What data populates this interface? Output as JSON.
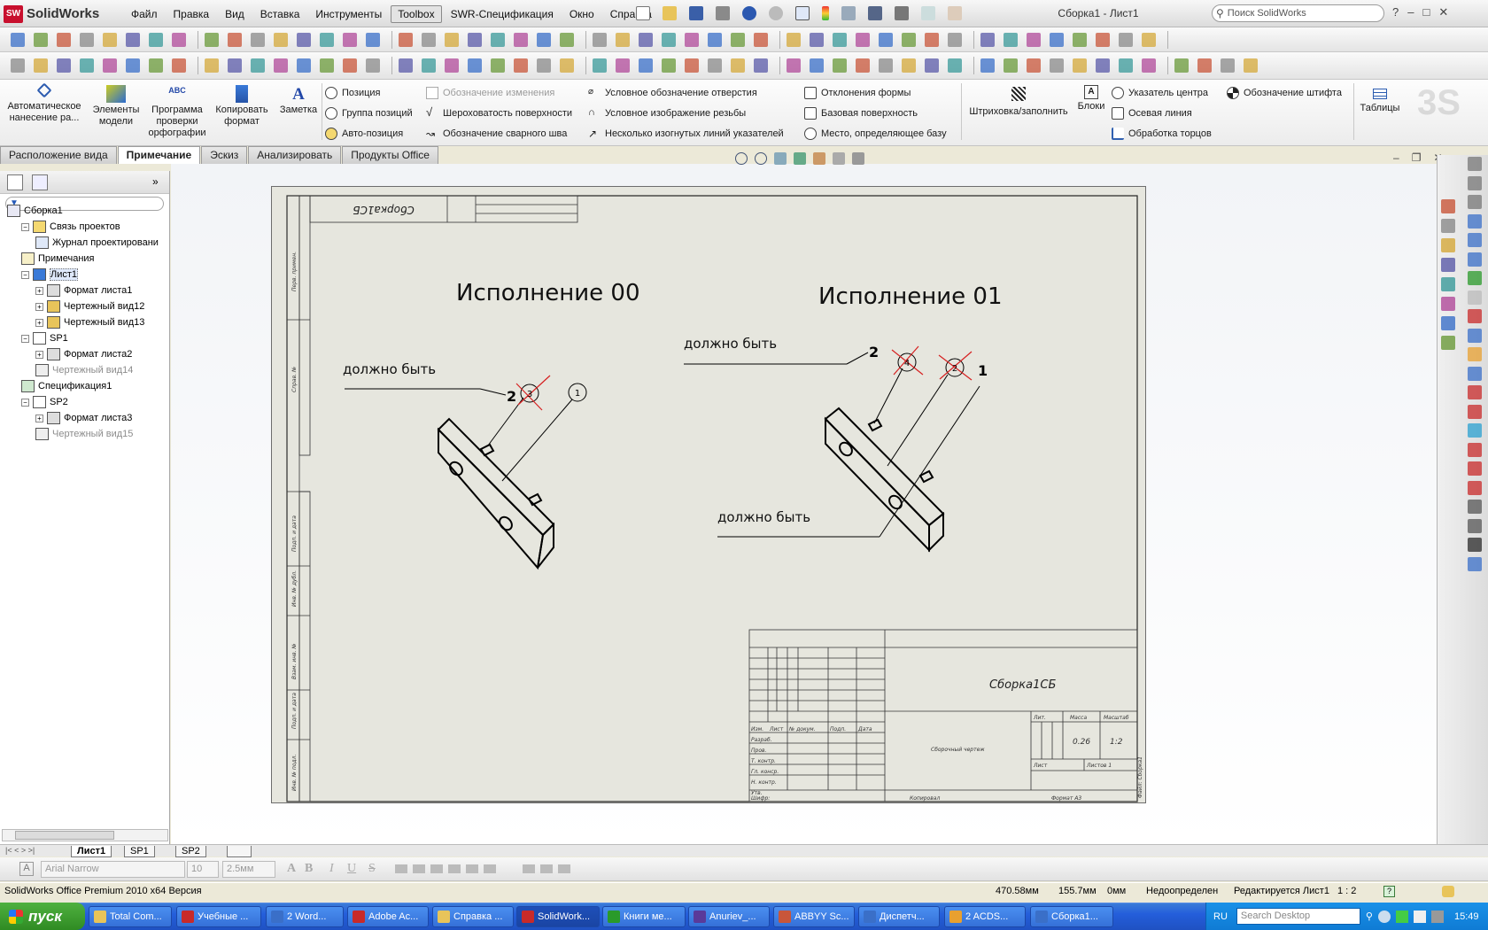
{
  "app": {
    "name": "SolidWorks",
    "logo_text": "SW",
    "doc_title": "Сборка1 - Лист1",
    "search_placeholder": "Поиск SolidWorks"
  },
  "menu": [
    "Файл",
    "Правка",
    "Вид",
    "Вставка",
    "Инструменты",
    "Toolbox",
    "SWR-Спецификация",
    "Окно",
    "Справка"
  ],
  "command_manager": {
    "big": [
      {
        "label": "Автоматическое нанесение ра...",
        "icon": "auto-dimension-icon"
      },
      {
        "label": "Элементы модели",
        "icon": "model-items-icon"
      },
      {
        "label": "Программа проверки орфографии",
        "icon": "spell-check-icon"
      },
      {
        "label": "Копировать формат",
        "icon": "format-painter-icon"
      },
      {
        "label": "Заметка",
        "icon": "note-icon"
      }
    ],
    "col1": [
      "Позиция",
      "Группа позиций",
      "Авто-позиция"
    ],
    "col2": [
      "Обозначение изменения",
      "Шероховатость поверхности",
      "Обозначение сварного шва"
    ],
    "col3": [
      "Условное обозначение отверстия",
      "Условное изображение резьбы",
      "Несколько изогнутых линий указателей"
    ],
    "col4": [
      "Отклонения формы",
      "Базовая поверхность",
      "Место, определяющее базу"
    ],
    "hatch": "Штриховка/заполнить",
    "blocks": "Блоки",
    "col5": [
      "Указатель центра",
      "Осевая линия",
      "Обработка торцов"
    ],
    "pin": "Обозначение штифта",
    "tables": "Таблицы"
  },
  "tabs": [
    "Расположение вида",
    "Примечание",
    "Эскиз",
    "Анализировать",
    "Продукты Office"
  ],
  "tree": [
    {
      "label": "Сборка1",
      "gray": false
    },
    {
      "label": "Связь проектов",
      "gray": false
    },
    {
      "label": "Журнал проектировани",
      "gray": false
    },
    {
      "label": "Примечания",
      "gray": false
    },
    {
      "label": "Лист1",
      "gray": false
    },
    {
      "label": "Формат листа1",
      "gray": false
    },
    {
      "label": "Чертежный вид12",
      "gray": false
    },
    {
      "label": "Чертежный вид13",
      "gray": false
    },
    {
      "label": "SP1",
      "gray": false
    },
    {
      "label": "Формат листа2",
      "gray": false
    },
    {
      "label": "Чертежный вид14",
      "gray": true
    },
    {
      "label": "Спецификация1",
      "gray": false
    },
    {
      "label": "SP2",
      "gray": false
    },
    {
      "label": "Формат листа3",
      "gray": false
    },
    {
      "label": "Чертежный вид15",
      "gray": true
    }
  ],
  "drawing": {
    "stamp_top": "Сборка1СБ",
    "title_left": "Исполнение 00",
    "title_right": "Исполнение 01",
    "note": "должно быть",
    "left_balloons": {
      "wrong": "3",
      "other": "1",
      "correct": "2"
    },
    "right_balloons": {
      "wrong_a": "4",
      "wrong_b": "2",
      "correct_a": "2",
      "correct_b": "1"
    },
    "side_labels": [
      "Перв. примен.",
      "Справ. №",
      "Подп. и дата",
      "Инв. № дубл.",
      "Взам. инв. №",
      "Подп. и дата",
      "Инв. № подл."
    ],
    "title_block": {
      "designation": "Сборка1СБ",
      "name": "Сборочный чертеж",
      "lit": "Лит.",
      "mass_label": "Масса",
      "scale_label": "Масштаб",
      "mass": "0.26",
      "scale": "1:2",
      "sheet": "Лист",
      "sheets": "Листов 1",
      "headers": [
        "Изм.",
        "Лист",
        "№ докум.",
        "Подп.",
        "Дата"
      ],
      "rows": [
        "Разраб.",
        "Пров.",
        "Т. контр.",
        "Гл. конср.",
        "Н. контр.",
        "Утв."
      ],
      "copied": "Копировал",
      "format": "Формат А3",
      "footer_left": "Шифр:",
      "side": "Файл: Сборка1"
    }
  },
  "sheet_tabs": [
    "Лист1",
    "SP1",
    "SP2"
  ],
  "format_bar": {
    "font": "Arial Narrow",
    "size": "10",
    "height": "2.5мм"
  },
  "status": {
    "left": "SolidWorks Office Premium 2010 x64 Версия",
    "x": "470.58мм",
    "y": "155.7мм",
    "z": "0мм",
    "state": "Недоопределен",
    "editing": "Редактируется Лист1",
    "scale": "1 : 2"
  },
  "taskbar": {
    "start": "пуск",
    "tasks": [
      "Total Com...",
      "Учебные ...",
      "2 Word...",
      "Adobe Ac...",
      "Справка ...",
      "SolidWork...",
      "Книги ме...",
      "Anuriev_...",
      "ABBYY Sc...",
      "Диспетч...",
      "2 ACDS...",
      "Сборка1..."
    ],
    "lang": "RU",
    "search": "Search Desktop",
    "time": "15:49"
  }
}
